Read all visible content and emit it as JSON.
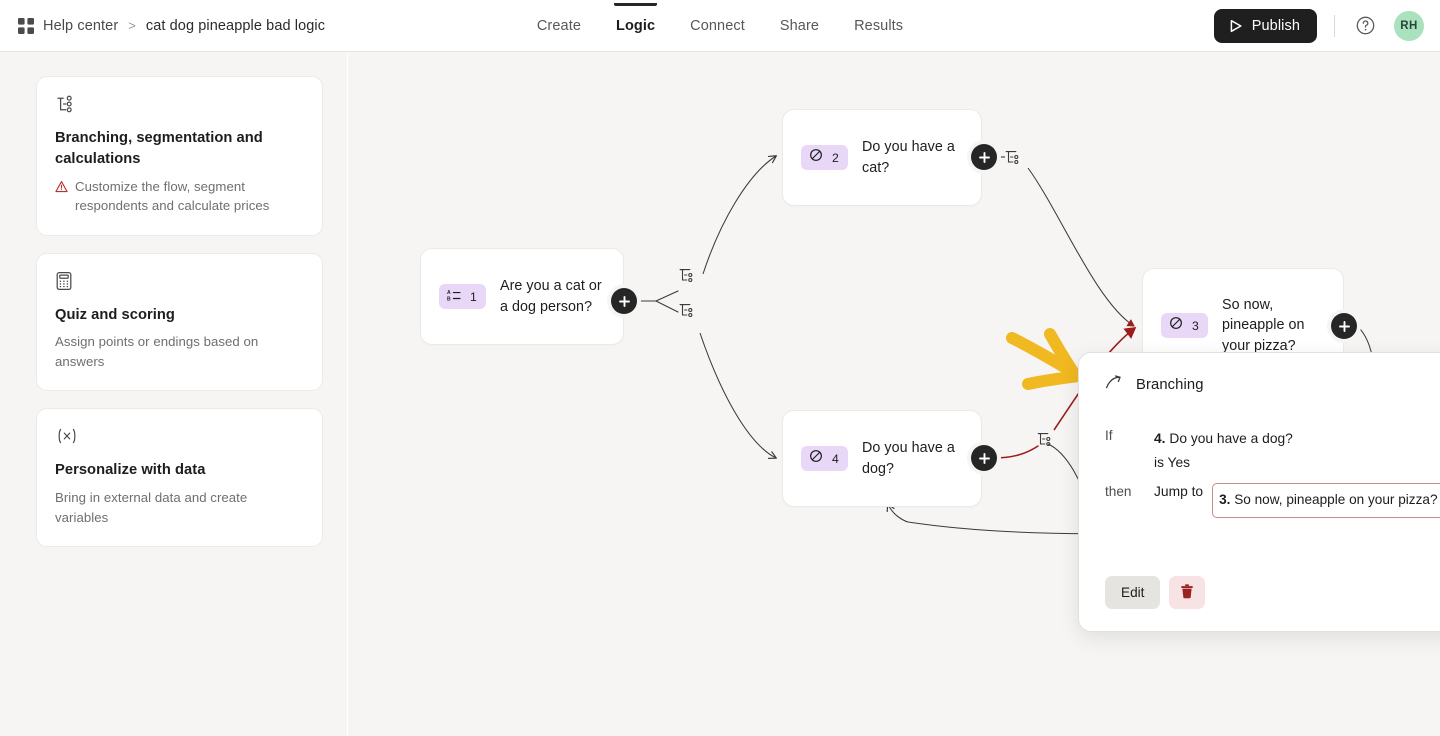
{
  "header": {
    "breadcrumb": {
      "app_link": "Help center",
      "separator": ">",
      "current": "cat dog pineapple bad logic"
    },
    "tabs": [
      {
        "label": "Create",
        "active": false
      },
      {
        "label": "Logic",
        "active": true
      },
      {
        "label": "Connect",
        "active": false
      },
      {
        "label": "Share",
        "active": false
      },
      {
        "label": "Results",
        "active": false
      }
    ],
    "publish_label": "Publish",
    "avatar_initials": "RH"
  },
  "sidebar": {
    "cards": [
      {
        "icon": "branching-icon",
        "title": "Branching, segmentation and calculations",
        "desc": "Customize the flow, segment respondents and calculate prices",
        "warning": true
      },
      {
        "icon": "calculator-icon",
        "title": "Quiz and scoring",
        "desc": "Assign points or endings based on answers",
        "warning": false
      },
      {
        "icon": "variable-icon",
        "title": "Personalize with data",
        "desc": "Bring in external data and create variables",
        "warning": false
      }
    ]
  },
  "canvas": {
    "nodes": [
      {
        "number": "1",
        "type_icon": "multiple-choice-icon",
        "text": "Are you a cat or a dog person?"
      },
      {
        "number": "2",
        "type_icon": "yes-no-icon",
        "text": "Do you have a cat?"
      },
      {
        "number": "3",
        "type_icon": "yes-no-icon",
        "text": "So now, pineapple on your pizza?"
      },
      {
        "number": "4",
        "type_icon": "yes-no-icon",
        "text": "Do you have a dog?"
      }
    ],
    "annotation_color": "#f0b821",
    "error_edge_color": "#9b1c1c"
  },
  "panel": {
    "title": "Branching",
    "if_label": "If",
    "then_label": "then",
    "condition_number": "4.",
    "condition_question": "Do you have a dog?",
    "condition_operator": "is Yes",
    "jump_label": "Jump to",
    "target_number": "3.",
    "target_question": "So now, pineapple on your pizza?",
    "error_mark": "!",
    "edit_label": "Edit"
  }
}
